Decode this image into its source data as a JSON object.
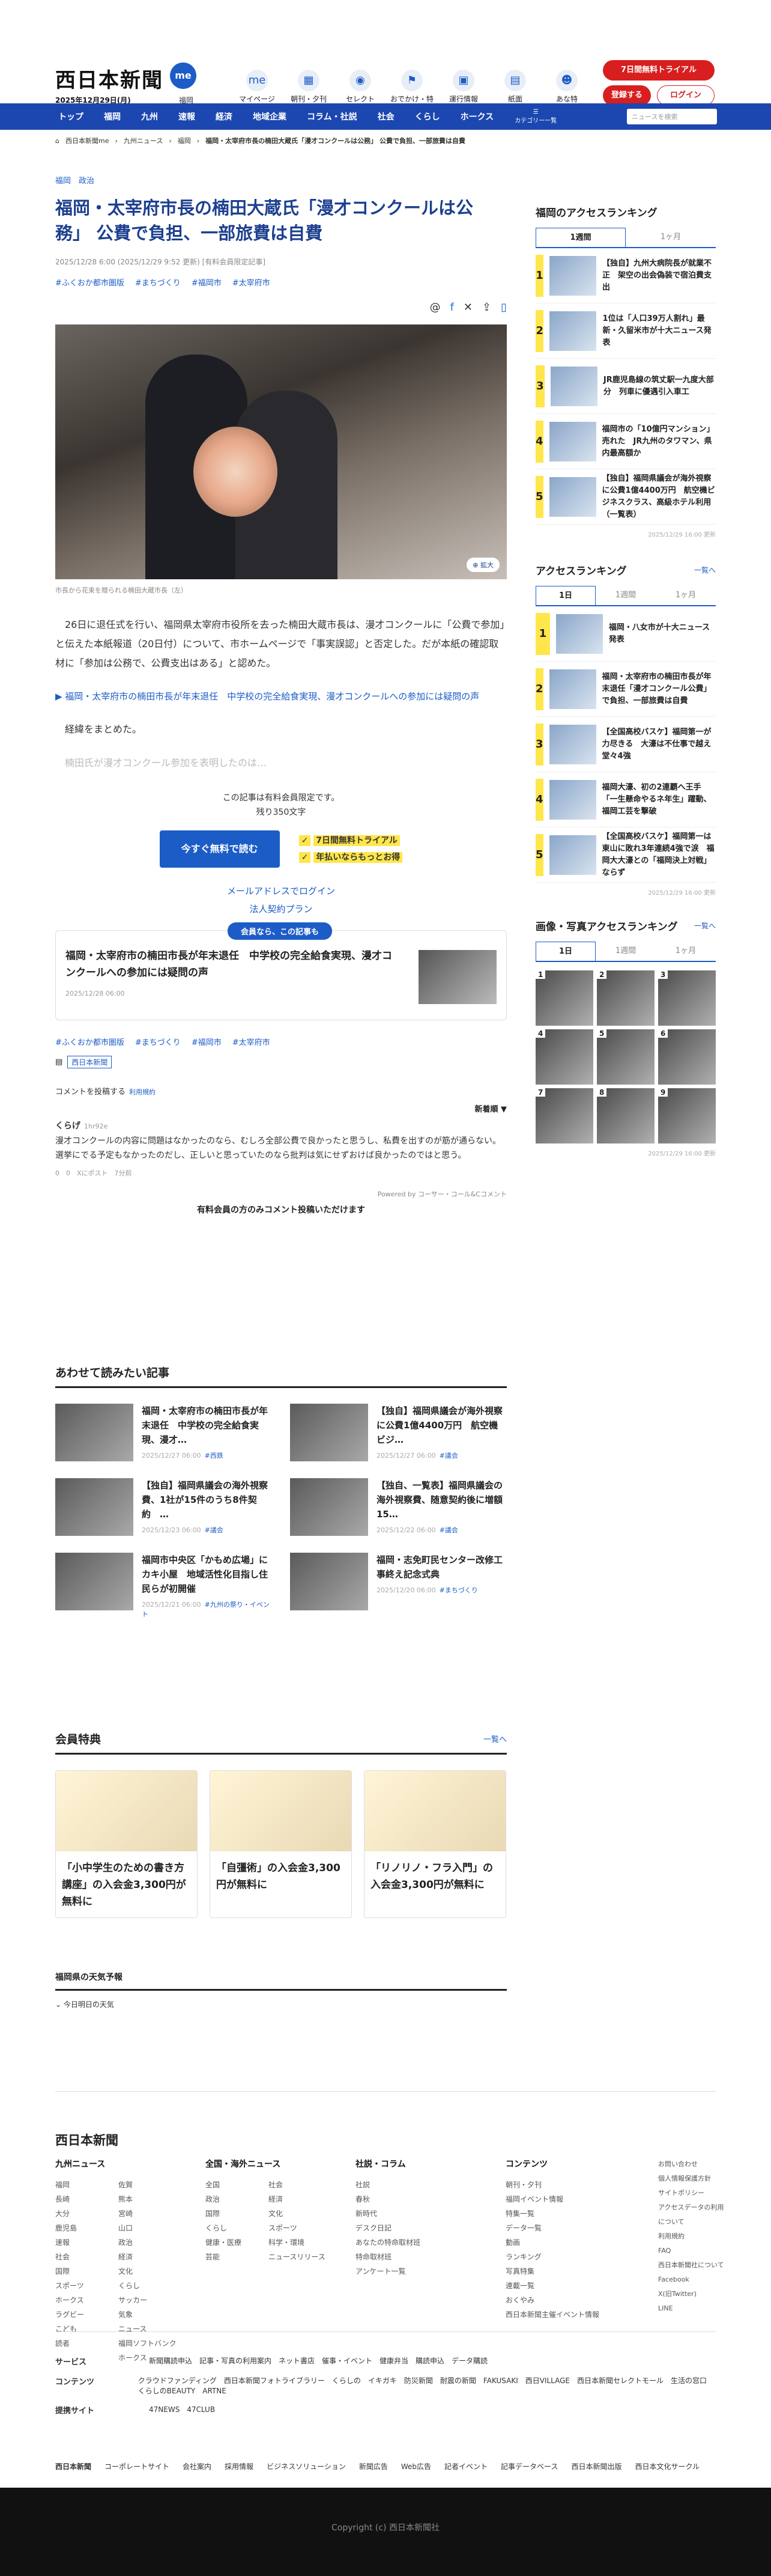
{
  "header": {
    "logo": "西日本新聞",
    "logo_me": "me",
    "date": "2025年12月29日(月)",
    "locale": "福岡",
    "icons": [
      {
        "label": "マイページ",
        "icon": "user-icon"
      },
      {
        "label": "朝刊・夕刊",
        "icon": "newspaper-icon"
      },
      {
        "label": "セレクト",
        "icon": "select-icon"
      },
      {
        "label": "おでかけ・特典",
        "icon": "walk-icon"
      },
      {
        "label": "運行情報",
        "icon": "train-icon"
      },
      {
        "label": "紙面",
        "icon": "paper-icon"
      },
      {
        "label": "あな特",
        "icon": "raccoon-icon"
      }
    ],
    "trial": "7日間無料トライアル",
    "register": "登録する",
    "login": "ログイン"
  },
  "nav": {
    "items": [
      "トップ",
      "福岡",
      "九州",
      "速報",
      "経済",
      "地域企業",
      "コラム・社説",
      "社会",
      "くらし",
      "ホークス"
    ],
    "category": "カテゴリー一覧",
    "search_placeholder": "ニュースを検索"
  },
  "breadcrumb": [
    "西日本新聞me",
    "九州ニュース",
    "福岡",
    "福岡・太宰府市長の楠田大蔵氏「漫才コンクールは公務」 公費で負担、一部旅費は自費"
  ],
  "article": {
    "categories": "福岡　政治",
    "title": "福岡・太宰府市長の楠田大蔵氏「漫才コンクールは公務」 公費で負担、一部旅費は自費",
    "meta": "2025/12/28 6:00 (2025/12/29 9:52 更新) [有料会員限定記事]",
    "tags": [
      "#ふくおか都市圏版",
      "#まちづくり",
      "#福岡市",
      "#太宰府市"
    ],
    "zoom": "拡大",
    "caption": "市長から花束を贈られる楠田大蔵市長（左）",
    "para1": "26日に退任式を行い、福岡県太宰府市役所を去った楠田大蔵市長は、漫才コンクールに「公費で参加」と伝えた本紙報道（20日付）について、市ホームページで「事実誤認」と否定した。だが本紙の確認取材に「参加は公務で、公費支出はある」と認めた。",
    "link": "▶ 福岡・太宰府市の楠田市長が年末退任　中学校の完全給食実現、漫才コンクールへの参加には疑問の声",
    "para2": "経緯をまとめた。",
    "para3": "楠田氏が漫才コンクール参加を表明したのは…"
  },
  "paywall": {
    "line1": "この記事は有料会員限定です。",
    "line2": "残り350文字",
    "button": "今すぐ無料で読む",
    "point1": "7日間無料トライアル",
    "point2": "年払いならもっとお得",
    "mail_login": "メールアドレスでログイン",
    "corp": "法人契約プラン"
  },
  "memberbox": {
    "badge": "会員なら、この記事も",
    "title": "福岡・太宰府市の楠田市長が年末退任　中学校の完全給食実現、漫才コンクールへの参加には疑問の声",
    "date": "2025/12/28 06:00"
  },
  "tags2": [
    "#ふくおか都市圏版",
    "#まちづくり",
    "#福岡市",
    "#太宰府市"
  ],
  "tags3_badge": "西日本新聞",
  "comments": {
    "post": "コメントを投稿する",
    "terms": "利用規約",
    "sort": "新着順 ▼",
    "user": "くらげ",
    "time": "1hr92e",
    "text": "漫才コンクールの内容に問題はなかったのなら、むしろ全部公費で良かったと思うし、私費を出すのが筋が通らない。選挙にでる予定もなかったのだし、正しいと思っていたのなら批判は気にせずおけば良かったのではと思う。",
    "foot": "0　0　Xにポスト　7分前",
    "powered": "Powered by コーサー・コール&Cコメント",
    "only": "有料会員の方のみコメント投稿いただけます"
  },
  "related": {
    "title": "あわせて読みたい記事",
    "items": [
      {
        "title": "福岡・太宰府市の楠田市長が年末退任　中学校の完全給食実現、漫才…",
        "date": "2025/12/27 06:00",
        "tag": "#西鉄"
      },
      {
        "title": "【独自】福岡県議会が海外視察に公費1億4400万円　航空機ビジ…",
        "date": "2025/12/27 06:00",
        "tag": "#議会"
      },
      {
        "title": "【独自】福岡県議会の海外視察費、1社が15件のうち8件契約　…",
        "date": "2025/12/23 06:00",
        "tag": "#議会"
      },
      {
        "title": "【独自、一覧表】福岡県議会の海外視察費、随意契約後に増額　15…",
        "date": "2025/12/22 06:00",
        "tag": "#議会"
      },
      {
        "title": "福岡市中央区「かもめ広場」にカキ小屋　地域活性化目指し住民らが初開催",
        "date": "2025/12/21 06:00",
        "tag": "#九州の祭り・イベント"
      },
      {
        "title": "福岡・志免町民センター改修工事終え記念式典",
        "date": "2025/12/20 06:00",
        "tag": "#まちづくり"
      }
    ]
  },
  "perks": {
    "title": "会員特典",
    "more": "一覧へ",
    "items": [
      "「小中学生のための書き方講座」の入会金3,300円が無料に",
      "「自彊術」の入会金3,300円が無料に",
      "「リノリノ・フラ入門」の入会金3,300円が無料に"
    ]
  },
  "weather": {
    "title": "福岡県の天気予報",
    "sub": "今日明日の天気"
  },
  "sidebar": {
    "access_title": "福岡のアクセスランキング",
    "tabs1": [
      "1週間",
      "1ヶ月"
    ],
    "rank1": [
      "【独自】九州大病院長が就業不正　架空の出会偽装で宿泊費支出",
      "1位は「人口39万人割れ」最新・久留米市が十大ニュース発表",
      "JR鹿児島線の筑丈駅一九度大部分　列車に優遇引入車工",
      "福岡市の「10億円マンション」売れた　JR九州のタワマン、県内最高額か",
      "【独自】福岡県議会が海外視察に公費1億4400万円　航空機ビジネスクラス、高級ホテル利用（一覧表）"
    ],
    "note1": "2025/12/29 16:00 更新",
    "access2_title": "アクセスランキング",
    "access2_more": "一覧へ",
    "tabs2": [
      "1日",
      "1週間",
      "1ヶ月"
    ],
    "rank2": [
      "福岡・八女市が十大ニュース発表",
      "福岡・太宰府市の楠田市長が年末退任「漫才コンクール公費」で負担、一部旅費は自費",
      "【全国高校バスケ】福岡第一が力尽きる　大濠は不仕事で越え堂々4強",
      "福岡大濠、初の2連覇へ王手　「一生懸命やるネ年生」躍動、福岡工芸を撃破",
      "【全国高校バスケ】福岡第一は東山に敗れ3年連続4強で涙　福岡大大濠との「福岡決上対戦」ならず"
    ],
    "note2": "2025/12/29 16:00 更新",
    "photo_title": "画像・写真アクセスランキング",
    "photo_more": "一覧へ",
    "tabs3": [
      "1日",
      "1週間",
      "1ヶ月"
    ],
    "photo_nums": [
      "1",
      "2",
      "3",
      "4",
      "5",
      "6",
      "7",
      "8",
      "9"
    ],
    "note3": "2025/12/29 16:00 更新"
  },
  "footer": {
    "logo": "西日本新聞",
    "cols": [
      {
        "title": "九州ニュース",
        "items": [
          "福岡",
          "佐賀",
          "長崎",
          "熊本",
          "大分",
          "宮崎",
          "鹿児島",
          "山口",
          "速報",
          "政治",
          "社会",
          "経済",
          "国際",
          "文化",
          "スポーツ",
          "くらし",
          "ホークス",
          "サッカー",
          "ラグビー",
          "気象",
          "こども",
          "ニュース",
          "読者",
          "福岡ソフトバンクホークス"
        ]
      },
      {
        "title": "全国・海外ニュース",
        "items": [
          "全国",
          "社会",
          "政治",
          "経済",
          "国際",
          "文化",
          "くらし",
          "スポーツ",
          "健康・医療",
          "科学・環境",
          "芸能",
          "ニュースリリース"
        ]
      },
      {
        "title": "社説・コラム",
        "items": [
          "社説",
          "春秋",
          "新時代",
          "デスク日記",
          "あなたの特命取材班",
          "特命取材班",
          "アンケート一覧"
        ]
      },
      {
        "title": "コンテンツ",
        "items": [
          "朝刊・夕刊",
          "福岡イベント情報",
          "特集一覧",
          "データ一覧",
          "動画",
          "ランキング",
          "写真特集",
          "連載一覧",
          "おくやみ",
          "西日本新聞主催イベント情報"
        ]
      }
    ],
    "side": [
      "お問い合わせ",
      "個人情報保護方針",
      "サイトポリシー",
      "アクセスデータの利用について",
      "利用規約",
      "FAQ",
      "西日本新聞社について",
      "Facebook",
      "X(旧Twitter)",
      "LINE"
    ],
    "rows": [
      {
        "label": "サービス",
        "text": "新聞購読申込　記事・写真の利用案内　ネット書店　催事・イベント　健康弁当　購読申込　データ購読"
      },
      {
        "label": "コンテンツ",
        "text": "クラウドファンディング　西日本新聞フォトライブラリー　くらしの　イキガキ　防災新聞　耐震の新聞　FAKUSAKI　西日VILLAGE　西日本新聞セレクトモール　生活の窓口　くらしのBEAUTY　ARTNE"
      },
      {
        "label": "提携サイト",
        "text": "47NEWS　47CLUB"
      }
    ],
    "bottom": [
      "西日本新聞",
      "コーポレートサイト",
      "会社案内",
      "採用情報",
      "ビジネスソリューション",
      "新聞広告",
      "Web広告",
      "記者イベント",
      "記事データベース",
      "西日本新聞出版",
      "西日本文化サークル"
    ],
    "copyright": "Copyright (c) 西日本新聞社"
  }
}
